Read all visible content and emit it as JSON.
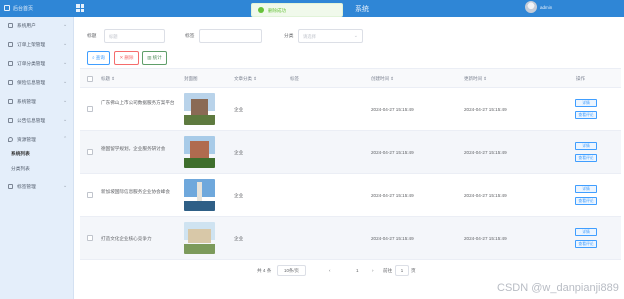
{
  "header": {
    "home_label": "后台首页",
    "system_title": "系统",
    "username": "admin"
  },
  "toast": {
    "message": "删除成功"
  },
  "sidebar": {
    "items": [
      {
        "label": "系统用户",
        "chevron": "⌄"
      },
      {
        "label": "订单上架管理",
        "chevron": "⌄"
      },
      {
        "label": "订单分类管理",
        "chevron": "⌄"
      },
      {
        "label": "保险信息管理",
        "chevron": "⌄"
      },
      {
        "label": "系统管理",
        "chevron": "⌄"
      },
      {
        "label": "公告信息管理",
        "chevron": "⌄"
      },
      {
        "label": "资源管理",
        "chevron": "⌃"
      },
      {
        "label": "系统列表",
        "active": true
      },
      {
        "label": "分类列表"
      },
      {
        "label": "标签管理",
        "chevron": "⌄"
      }
    ]
  },
  "filters": {
    "title_label": "标题",
    "title_placeholder": "标题",
    "tag_label": "标签",
    "tag_placeholder": "",
    "category_label": "分类",
    "category_placeholder": "请选择"
  },
  "toolbar": {
    "search_label": "查询",
    "delete_label": "删除",
    "stats_label": "统计"
  },
  "table": {
    "columns": [
      "标题 ⇕",
      "封面图",
      "文章分类 ⇕",
      "标签",
      "创建时间 ⇕",
      "更新时间 ⇕",
      "操作"
    ],
    "rows": [
      {
        "title": "广东佛山上市公司数据服务方案平台",
        "category": "企业",
        "tags": "",
        "created": "2024-04-27 15:15:49",
        "updated": "2024-04-27 15:15:49",
        "thumb": {
          "sky": "#b9d3ea",
          "bld": "#8a6a55",
          "gnd": "#5e7a3f"
        }
      },
      {
        "title": "德国留学规划，企业服务研讨会",
        "category": "企业",
        "tags": "",
        "created": "2024-04-27 15:15:49",
        "updated": "2024-04-27 15:15:49",
        "thumb": {
          "sky": "#a8cbe8",
          "bld": "#b06b4f",
          "gnd": "#3f6f2d"
        }
      },
      {
        "title": "新加坡国际信息服务企业协会峰会",
        "category": "企业",
        "tags": "",
        "created": "2024-04-27 15:15:49",
        "updated": "2024-04-27 15:15:49",
        "thumb": {
          "sky": "#6fa8dc",
          "bld": "#e7e3da",
          "gnd": "#2f5f86"
        }
      },
      {
        "title": "打造文化企业核心竞争力",
        "category": "企业",
        "tags": "",
        "created": "2024-04-27 15:15:49",
        "updated": "2024-04-27 15:15:49",
        "thumb": {
          "sky": "#cfe3f1",
          "bld": "#d8c8a8",
          "gnd": "#7c9a5b"
        }
      }
    ],
    "action_edit": "详情",
    "action_view": "查看评论"
  },
  "pagination": {
    "total_label": "共 4 条",
    "page_size": "10条/页",
    "prev": "‹",
    "current_page": "1",
    "next": "›",
    "goto_label": "前往",
    "goto_value": "1",
    "page_suffix": "页"
  },
  "watermark": "CSDN @w_danpianji889"
}
